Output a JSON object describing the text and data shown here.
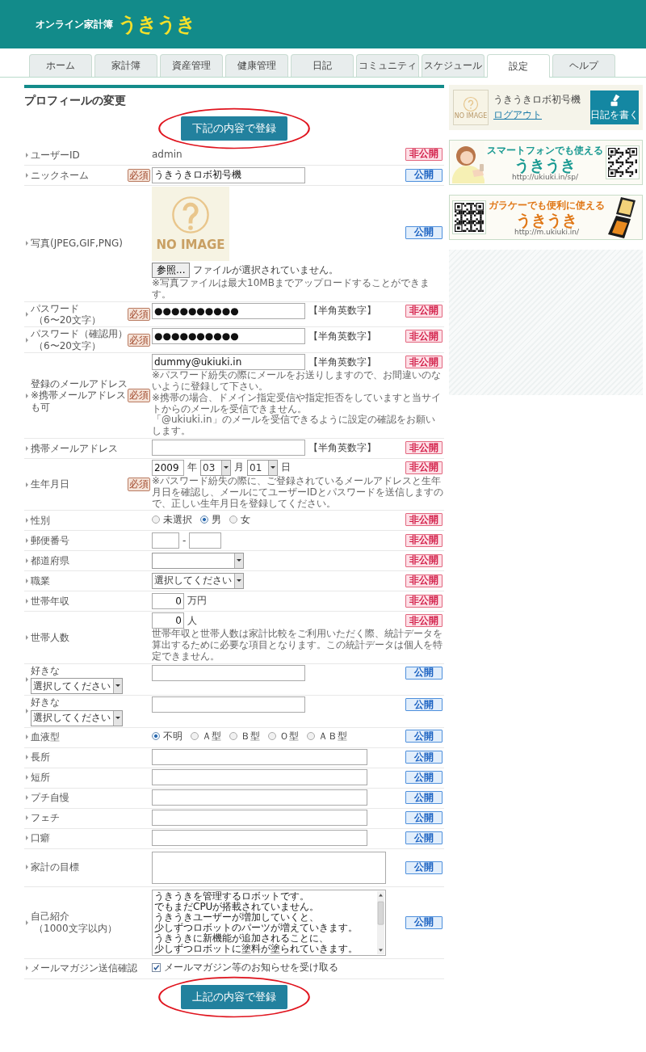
{
  "header": {
    "tagline": "オンライン家計簿",
    "logo": "うきうき"
  },
  "tabs": [
    {
      "label": "ホーム",
      "selected": false
    },
    {
      "label": "家計簿",
      "selected": false
    },
    {
      "label": "資産管理",
      "selected": false
    },
    {
      "label": "健康管理",
      "selected": false
    },
    {
      "label": "日記",
      "selected": false
    },
    {
      "label": "コミュニティ",
      "selected": false
    },
    {
      "label": "スケジュール",
      "selected": false
    },
    {
      "label": "設定",
      "selected": true
    },
    {
      "label": "ヘルプ",
      "selected": false
    }
  ],
  "page_title": "プロフィールの変更",
  "submit_top": {
    "label": "下記の内容で登録",
    "circled": true
  },
  "rows": [
    {
      "kind": "text",
      "label": [
        "ユーザーID"
      ],
      "value": "admin",
      "visibility": {
        "label": "非公開",
        "public": false
      }
    },
    {
      "kind": "input",
      "label": [
        "ニックネーム"
      ],
      "badge": "必須",
      "value": "うきうきロボ初号機",
      "visibility": {
        "label": "公開",
        "public": true
      }
    },
    {
      "label": [
        "写真(JPEG,GIF,PNG)"
      ],
      "image_text": "NO IMAGE",
      "button": "参照...",
      "status": "ファイルが選択されていません。",
      "note": [
        "※写真ファイルは最大10MBまでアップロードすることができます。"
      ],
      "visibility": {
        "label": "公開",
        "public": true
      }
    },
    {
      "kind": "input",
      "label": [
        "パスワード",
        "（6〜20文字）"
      ],
      "badge": "必須",
      "value": "●●●●●●●●●●",
      "hint": "【半角英数字】",
      "visibility": {
        "label": "非公開",
        "public": false
      }
    },
    {
      "kind": "input",
      "label": [
        "パスワード（確認用）",
        "（6〜20文字）"
      ],
      "badge": "必須",
      "value": "●●●●●●●●●●",
      "hint": "【半角英数字】",
      "visibility": {
        "label": "非公開",
        "public": false
      }
    },
    {
      "kind": "input",
      "label": [
        "登録のメールアドレス",
        "※携帯メールアドレス",
        "も可"
      ],
      "badge": "必須",
      "value": "dummy@ukiuki.in",
      "hint": "【半角英数字】",
      "note": [
        "※パスワード紛失の際にメールをお送りしますので、お間違いのないように登録して下さい。",
        "※携帯の場合、ドメイン指定受信や指定拒否をしていますと当サイトからのメールを受信できません。",
        "「@ukiuki.in」のメールを受信できるように設定の確認をお願いします。"
      ],
      "visibility": {
        "label": "非公開",
        "public": false
      }
    },
    {
      "kind": "input",
      "label": [
        "携帯メールアドレス"
      ],
      "hint": "【半角英数字】",
      "visibility": {
        "label": "非公開",
        "public": false
      }
    },
    {
      "kind": "date",
      "label": [
        "生年月日"
      ],
      "badge": "必須",
      "year": "2009",
      "year_unit": "年",
      "month": "03",
      "month_unit": "月",
      "day": "01",
      "day_unit": "日",
      "note": [
        "※パスワード紛失の際に、ご登録されているメールアドレスと生年月日を確認し、メールにてユーザーIDとパスワードを送信しますので、正しい生年月日を登録してください。"
      ],
      "visibility": {
        "label": "非公開",
        "public": false
      }
    },
    {
      "kind": "radio",
      "label": [
        "性別"
      ],
      "options": [
        {
          "label": "未選択",
          "selected": false
        },
        {
          "label": "男",
          "selected": true
        },
        {
          "label": "女",
          "selected": false
        }
      ],
      "visibility": {
        "label": "非公開",
        "public": false
      }
    },
    {
      "kind": "zip",
      "label": [
        "郵便番号"
      ],
      "separator": "-",
      "visibility": {
        "label": "非公開",
        "public": false
      }
    },
    {
      "kind": "select",
      "label": [
        "都道府県"
      ],
      "visibility": {
        "label": "非公開",
        "public": false
      }
    },
    {
      "kind": "select",
      "label": [
        "職業"
      ],
      "value": "選択してください",
      "visibility": {
        "label": "非公開",
        "public": false
      }
    },
    {
      "kind": "number",
      "label": [
        "世帯年収"
      ],
      "value": "0",
      "unit": "万円",
      "visibility": {
        "label": "非公開",
        "public": false
      }
    },
    {
      "kind": "number",
      "label": [
        "世帯人数"
      ],
      "value": "0",
      "unit": "人",
      "note": [
        "世帯年収と世帯人数は家計比較をご利用いただく際、統計データを算出するために必要な項目となります。この統計データは個人を特定できません。"
      ],
      "visibility": {
        "label": "非公開",
        "public": false
      }
    },
    {
      "kind": "favorite",
      "label": [
        "好きな"
      ],
      "select": "選択してください",
      "visibility": {
        "label": "公開",
        "public": true
      }
    },
    {
      "kind": "favorite",
      "label": [
        "好きな"
      ],
      "select": "選択してください",
      "visibility": {
        "label": "公開",
        "public": true
      }
    },
    {
      "kind": "radio",
      "label": [
        "血液型"
      ],
      "options": [
        {
          "label": "不明",
          "selected": true
        },
        {
          "label": "Ａ型",
          "selected": false
        },
        {
          "label": "Ｂ型",
          "selected": false
        },
        {
          "label": "Ｏ型",
          "selected": false
        },
        {
          "label": "ＡＢ型",
          "selected": false
        }
      ],
      "visibility": {
        "label": "公開",
        "public": true
      }
    },
    {
      "kind": "long",
      "label": [
        "長所"
      ],
      "visibility": {
        "label": "公開",
        "public": true
      }
    },
    {
      "kind": "long",
      "label": [
        "短所"
      ],
      "visibility": {
        "label": "公開",
        "public": true
      }
    },
    {
      "kind": "long",
      "label": [
        "プチ自慢"
      ],
      "visibility": {
        "label": "公開",
        "public": true
      }
    },
    {
      "kind": "long",
      "label": [
        "フェチ"
      ],
      "visibility": {
        "label": "公開",
        "public": true
      }
    },
    {
      "kind": "long",
      "label": [
        "口癖"
      ],
      "visibility": {
        "label": "公開",
        "public": true
      }
    },
    {
      "kind": "textarea",
      "label": [
        "家計の目標"
      ],
      "visibility": {
        "label": "公開",
        "public": true
      }
    },
    {
      "kind": "textarea",
      "label": [
        "自己紹介",
        "（1000文字以内）"
      ],
      "value": [
        "うきうきを管理するロボットです。",
        "でもまだCPUが搭載されていません。",
        "うきうきユーザーが増加していくと、",
        "少しずつロボットのパーツが増えていきます。",
        "うきうきに新機能が追加されることに、",
        "少しずつロボットに塗料が塗られていきます。"
      ],
      "visibility": {
        "label": "公開",
        "public": true
      }
    },
    {
      "kind": "checkbox",
      "label": [
        "メールマガジン送信確認"
      ],
      "checked": true,
      "text": "メールマガジン等のお知らせを受け取る"
    }
  ],
  "submit_bottom": {
    "label": "上記の内容で登録",
    "circled": true
  },
  "sidebar": {
    "profile": {
      "avatar_text": "NO IMAGE",
      "name": "うきうきロボ初号機",
      "logout": "ログアウト",
      "diary_button": "日記を書く"
    },
    "banners": [
      {
        "kind": "smartphone",
        "tagline": "スマートフォンでも使える",
        "logo": "うきうき",
        "url": "http://ukiuki.in/sp/"
      },
      {
        "kind": "feature_phone",
        "tagline": "ガラケーでも便利に使える",
        "logo": "うきうき",
        "url": "http://m.ukiuki.in/"
      }
    ]
  }
}
